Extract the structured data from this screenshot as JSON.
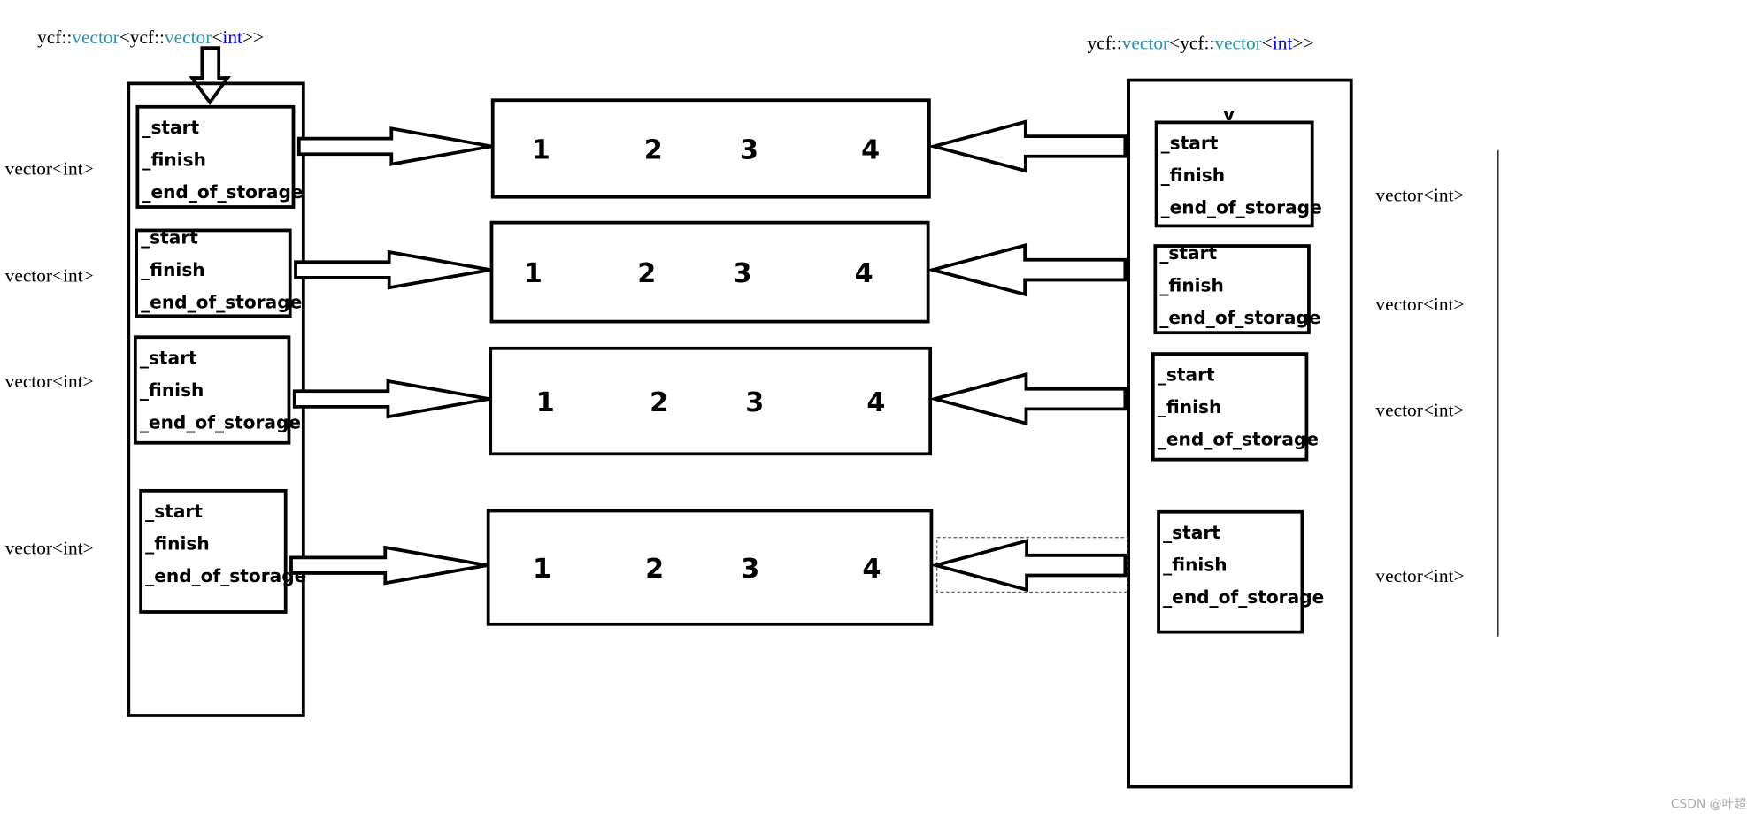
{
  "left_title": {
    "prefix": "ycf::",
    "vector1": "vector",
    "mid": "<ycf::",
    "vector2": "vector",
    "lt": "<",
    "int": "int",
    "suffix": ">>"
  },
  "right_title": {
    "prefix": "ycf::",
    "vector1": "vector",
    "mid": "<ycf::",
    "vector2": "vector",
    "lt": "<",
    "int": "int",
    "suffix": ">>"
  },
  "colors": {
    "type_name": "#2b91af",
    "keyword": "#0000ff",
    "text": "#000000"
  },
  "element_label": "vector<int>",
  "fields": [
    "_start",
    "_finish",
    "_end_of_storage"
  ],
  "rows": [
    {
      "values": [
        "1",
        "2",
        "3",
        "4"
      ]
    },
    {
      "values": [
        "1",
        "2",
        "3",
        "4"
      ]
    },
    {
      "values": [
        "1",
        "2",
        "3",
        "4"
      ]
    },
    {
      "values": [
        "1",
        "2",
        "3",
        "4"
      ]
    }
  ],
  "right_marker": "v",
  "watermark": "CSDN @叶超凡"
}
